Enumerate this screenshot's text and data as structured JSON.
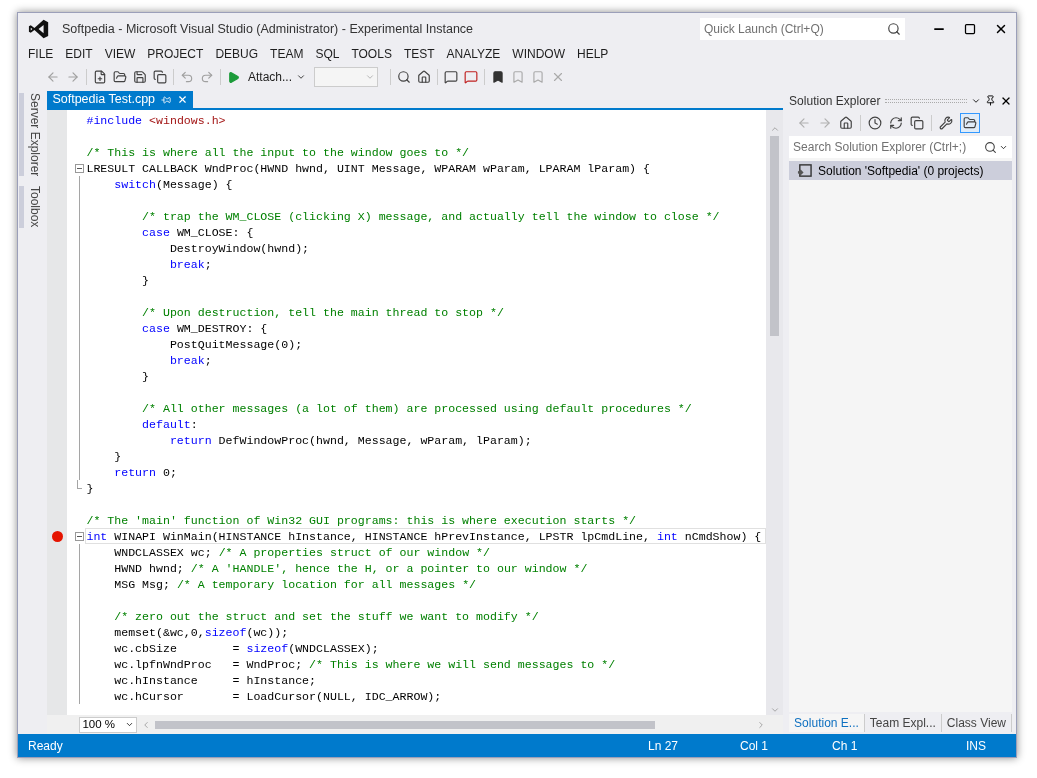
{
  "window": {
    "title": "Softpedia - Microsoft Visual Studio (Administrator) - Experimental Instance"
  },
  "quick_launch": {
    "placeholder": "Quick Launch (Ctrl+Q)"
  },
  "menu": [
    "FILE",
    "EDIT",
    "VIEW",
    "PROJECT",
    "DEBUG",
    "TEAM",
    "SQL",
    "TOOLS",
    "TEST",
    "ANALYZE",
    "WINDOW",
    "HELP"
  ],
  "toolbar": {
    "attach_button": "Attach..."
  },
  "side_tabs": [
    "Server Explorer",
    "Toolbox"
  ],
  "editor": {
    "tab": {
      "label": "Softpedia Test.cpp",
      "selected": true
    },
    "zoom": "100 %",
    "code_lines": [
      {
        "kind": "plain",
        "breakpoint": false,
        "current": false,
        "tokens": [
          {
            "kind": "kw",
            "text": "#include"
          },
          {
            "kind": "str",
            "text": " <windows.h>"
          }
        ]
      },
      {
        "kind": "plain",
        "breakpoint": false,
        "current": false
      },
      {
        "kind": "plain",
        "breakpoint": false,
        "current": false,
        "tokens": [
          {
            "kind": "com",
            "text": "/* This is where all the input to the window goes to */"
          }
        ]
      },
      {
        "kind": "foldhead",
        "breakpoint": false,
        "current": false,
        "tokens": [
          {
            "kind": "plain",
            "text": "LRESULT CALLBACK WndProc(HWND hwnd, UINT Message, WPARAM wParam, LPARAM lParam) {"
          }
        ]
      },
      {
        "kind": "foldbody",
        "breakpoint": false,
        "current": false,
        "tokens": [
          {
            "kind": "kw",
            "text": "    switch"
          },
          {
            "kind": "plain",
            "text": "(Message) {"
          }
        ]
      },
      {
        "kind": "foldbody",
        "breakpoint": false,
        "current": false
      },
      {
        "kind": "foldbody",
        "breakpoint": false,
        "current": false,
        "tokens": [
          {
            "kind": "com",
            "text": "        /* trap the WM_CLOSE (clicking X) message, and actually tell the window to close */"
          }
        ]
      },
      {
        "kind": "foldbody",
        "breakpoint": false,
        "current": false,
        "tokens": [
          {
            "kind": "kw",
            "text": "        case"
          },
          {
            "kind": "plain",
            "text": " WM_CLOSE: {"
          }
        ]
      },
      {
        "kind": "foldbody",
        "breakpoint": false,
        "current": false,
        "tokens": [
          {
            "kind": "plain",
            "text": "            DestroyWindow(hwnd);"
          }
        ]
      },
      {
        "kind": "foldbody",
        "breakpoint": false,
        "current": false,
        "tokens": [
          {
            "kind": "kw",
            "text": "            break"
          },
          {
            "kind": "plain",
            "text": ";"
          }
        ]
      },
      {
        "kind": "foldbody",
        "breakpoint": false,
        "current": false,
        "tokens": [
          {
            "kind": "plain",
            "text": "        }"
          }
        ]
      },
      {
        "kind": "foldbody",
        "breakpoint": false,
        "current": false
      },
      {
        "kind": "foldbody",
        "breakpoint": false,
        "current": false,
        "tokens": [
          {
            "kind": "com",
            "text": "        /* Upon destruction, tell the main thread to stop */"
          }
        ]
      },
      {
        "kind": "foldbody",
        "breakpoint": false,
        "current": false,
        "tokens": [
          {
            "kind": "kw",
            "text": "        case"
          },
          {
            "kind": "plain",
            "text": " WM_DESTROY: {"
          }
        ]
      },
      {
        "kind": "foldbody",
        "breakpoint": false,
        "current": false,
        "tokens": [
          {
            "kind": "plain",
            "text": "            PostQuitMessage(0);"
          }
        ]
      },
      {
        "kind": "foldbody",
        "breakpoint": false,
        "current": false,
        "tokens": [
          {
            "kind": "kw",
            "text": "            break"
          },
          {
            "kind": "plain",
            "text": ";"
          }
        ]
      },
      {
        "kind": "foldbody",
        "breakpoint": false,
        "current": false,
        "tokens": [
          {
            "kind": "plain",
            "text": "        }"
          }
        ]
      },
      {
        "kind": "foldbody",
        "breakpoint": false,
        "current": false
      },
      {
        "kind": "foldbody",
        "breakpoint": false,
        "current": false,
        "tokens": [
          {
            "kind": "com",
            "text": "        /* All other messages (a lot of them) are processed using default procedures */"
          }
        ]
      },
      {
        "kind": "foldbody",
        "breakpoint": false,
        "current": false,
        "tokens": [
          {
            "kind": "kw",
            "text": "        default"
          },
          {
            "kind": "plain",
            "text": ":"
          }
        ]
      },
      {
        "kind": "foldbody",
        "breakpoint": false,
        "current": false,
        "tokens": [
          {
            "kind": "kw",
            "text": "            return"
          },
          {
            "kind": "plain",
            "text": " DefWindowProc(hwnd, Message, wParam, lParam);"
          }
        ]
      },
      {
        "kind": "foldbody",
        "breakpoint": false,
        "current": false,
        "tokens": [
          {
            "kind": "plain",
            "text": "    }"
          }
        ]
      },
      {
        "kind": "foldbody",
        "breakpoint": false,
        "current": false,
        "tokens": [
          {
            "kind": "kw",
            "text": "    return"
          },
          {
            "kind": "plain",
            "text": " 0;"
          }
        ]
      },
      {
        "kind": "foldend",
        "breakpoint": false,
        "current": false,
        "tokens": [
          {
            "kind": "plain",
            "text": "}"
          }
        ]
      },
      {
        "kind": "plain",
        "breakpoint": false,
        "current": false
      },
      {
        "kind": "plain",
        "breakpoint": false,
        "current": false,
        "tokens": [
          {
            "kind": "com",
            "text": "/* The 'main' function of Win32 GUI programs: this is where execution starts */"
          }
        ]
      },
      {
        "kind": "foldhead",
        "breakpoint": true,
        "current": true,
        "tokens": [
          {
            "kind": "kw",
            "text": "int"
          },
          {
            "kind": "plain",
            "text": " WINAPI WinMain(HINSTANCE hInstance, HINSTANCE hPrevInstance, LPSTR lpCmdLine, "
          },
          {
            "kind": "kw",
            "text": "int"
          },
          {
            "kind": "plain",
            "text": " nCmdShow) {"
          }
        ]
      },
      {
        "kind": "foldbody",
        "breakpoint": false,
        "current": false,
        "tokens": [
          {
            "kind": "plain",
            "text": "    WNDCLASSEX wc; "
          },
          {
            "kind": "com",
            "text": "/* A properties struct of our window */"
          }
        ]
      },
      {
        "kind": "foldbody",
        "breakpoint": false,
        "current": false,
        "tokens": [
          {
            "kind": "plain",
            "text": "    HWND hwnd; "
          },
          {
            "kind": "com",
            "text": "/* A 'HANDLE', hence the H, or a pointer to our window */"
          }
        ]
      },
      {
        "kind": "foldbody",
        "breakpoint": false,
        "current": false,
        "tokens": [
          {
            "kind": "plain",
            "text": "    MSG Msg; "
          },
          {
            "kind": "com",
            "text": "/* A temporary location for all messages */"
          }
        ]
      },
      {
        "kind": "foldbody",
        "breakpoint": false,
        "current": false
      },
      {
        "kind": "foldbody",
        "breakpoint": false,
        "current": false,
        "tokens": [
          {
            "kind": "com",
            "text": "    /* zero out the struct and set the stuff we want to modify */"
          }
        ]
      },
      {
        "kind": "foldbody",
        "breakpoint": false,
        "current": false,
        "tokens": [
          {
            "kind": "plain",
            "text": "    memset(&wc,0,"
          },
          {
            "kind": "kw",
            "text": "sizeof"
          },
          {
            "kind": "plain",
            "text": "(wc));"
          }
        ]
      },
      {
        "kind": "foldbody",
        "breakpoint": false,
        "current": false,
        "tokens": [
          {
            "kind": "plain",
            "text": "    wc.cbSize        = "
          },
          {
            "kind": "kw",
            "text": "sizeof"
          },
          {
            "kind": "plain",
            "text": "(WNDCLASSEX);"
          }
        ]
      },
      {
        "kind": "foldbody",
        "breakpoint": false,
        "current": false,
        "tokens": [
          {
            "kind": "plain",
            "text": "    wc.lpfnWndProc   = WndProc; "
          },
          {
            "kind": "com",
            "text": "/* This is where we will send messages to */"
          }
        ]
      },
      {
        "kind": "foldbody",
        "breakpoint": false,
        "current": false,
        "tokens": [
          {
            "kind": "plain",
            "text": "    wc.hInstance     = hInstance;"
          }
        ]
      },
      {
        "kind": "foldbody",
        "breakpoint": false,
        "current": false,
        "tokens": [
          {
            "kind": "plain",
            "text": "    wc.hCursor       = LoadCursor(NULL, IDC_ARROW);"
          }
        ]
      }
    ]
  },
  "solution_explorer": {
    "title": "Solution Explorer",
    "search": {
      "placeholder": "Search Solution Explorer (Ctrl+;)"
    },
    "items": [
      {
        "label": "Solution 'Softpedia' (0 projects)",
        "selected": true
      }
    ],
    "bottom_tabs": [
      {
        "label": "Solution E...",
        "selected": true
      },
      {
        "label": "Team Expl...",
        "selected": false
      },
      {
        "label": "Class View",
        "selected": false
      }
    ]
  },
  "status_bar": {
    "message": "Ready",
    "line": "Ln 27",
    "column": "Col 1",
    "char": "Ch 1",
    "mode": "INS"
  }
}
